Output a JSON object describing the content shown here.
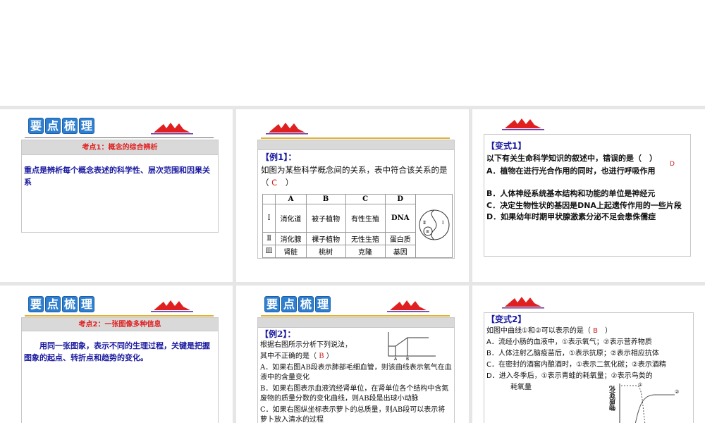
{
  "heading_tiles": [
    "要",
    "点",
    "梳",
    "理"
  ],
  "slide1": {
    "band": "考点1：概念的综合辨析",
    "body": "重点是辨析每个概念表述的科学性、层次范围和因果关系"
  },
  "slide2": {
    "label": "【例1】：",
    "question": "如图为某些科学概念间的关系，表中符合该关系的是（",
    "answer": "C",
    "close": "）",
    "table": {
      "headers": [
        "",
        "A",
        "B",
        "C",
        "D"
      ],
      "rows": [
        [
          "Ⅰ",
          "消化道",
          "被子植物",
          "有性生殖",
          "DNA"
        ],
        [
          "Ⅱ",
          "消化腺",
          "裸子植物",
          "无性生殖",
          "蛋白质"
        ],
        [
          "Ⅲ",
          "肾脏",
          "桃树",
          "克隆",
          "基因"
        ]
      ]
    },
    "diagram_labels": [
      "Ⅱ",
      "Ⅰ",
      "Ⅲ"
    ]
  },
  "slide3": {
    "label": "【变式1】",
    "question": "以下有关生命科学知识的叙述中，错误的是（　）",
    "answer": "D",
    "options": [
      "A．植物在进行光合作用的同时，也进行呼吸作用",
      "B．人体神经系统基本结构和功能的单位是神经元",
      "C．决定生物性状的基因是DNA上起遗传作用的一些片段",
      "D．如果幼年时期甲状腺激素分泌不足会患侏儒症"
    ]
  },
  "slide4": {
    "band": "考点2：一张图像多种信息",
    "body": "用同一张图象，表示不同的生理过程，关键是把握图象的起点、转折点和趋势的变化。"
  },
  "slide5": {
    "label": "【例2】：",
    "intro": "根据右图所示分析下列说法，",
    "question": "其中不正确的是（",
    "answer": "B",
    "close": "）",
    "options": [
      "A．如果右图AB段表示肺部毛细血管，则该曲线表示氧气在血液中的含量变化",
      "B．如果右图表示血液流经肾单位，在肾单位各个结构中含氮废物的质量分数的变化曲线，则AB段是出球小动脉",
      "C．如果右图纵坐标表示萝卜的总质量，则AB段可以表示将萝卜放入清水的过程"
    ],
    "graph_labels": [
      "A",
      "B"
    ]
  },
  "slide6": {
    "label": "【变式2】",
    "question": "如图中曲线①和②可以表示的是（",
    "answer": "B",
    "close": "）",
    "options": [
      "A．流经小肠的血液中，①表示氧气；②表示营养物质",
      "B．人体注射乙脑疫苗后，①表示抗原；②表示相应抗体",
      "C．在密封的酒窖内酿酒时，①表示二氧化碳；②表示酒精",
      "D．进入冬季后，①表示青蛙的耗氧量；②表示鸟类的耗氧量"
    ],
    "graph": {
      "ylabel": "物质变化",
      "curve1": "①",
      "curve2": "②"
    }
  }
}
